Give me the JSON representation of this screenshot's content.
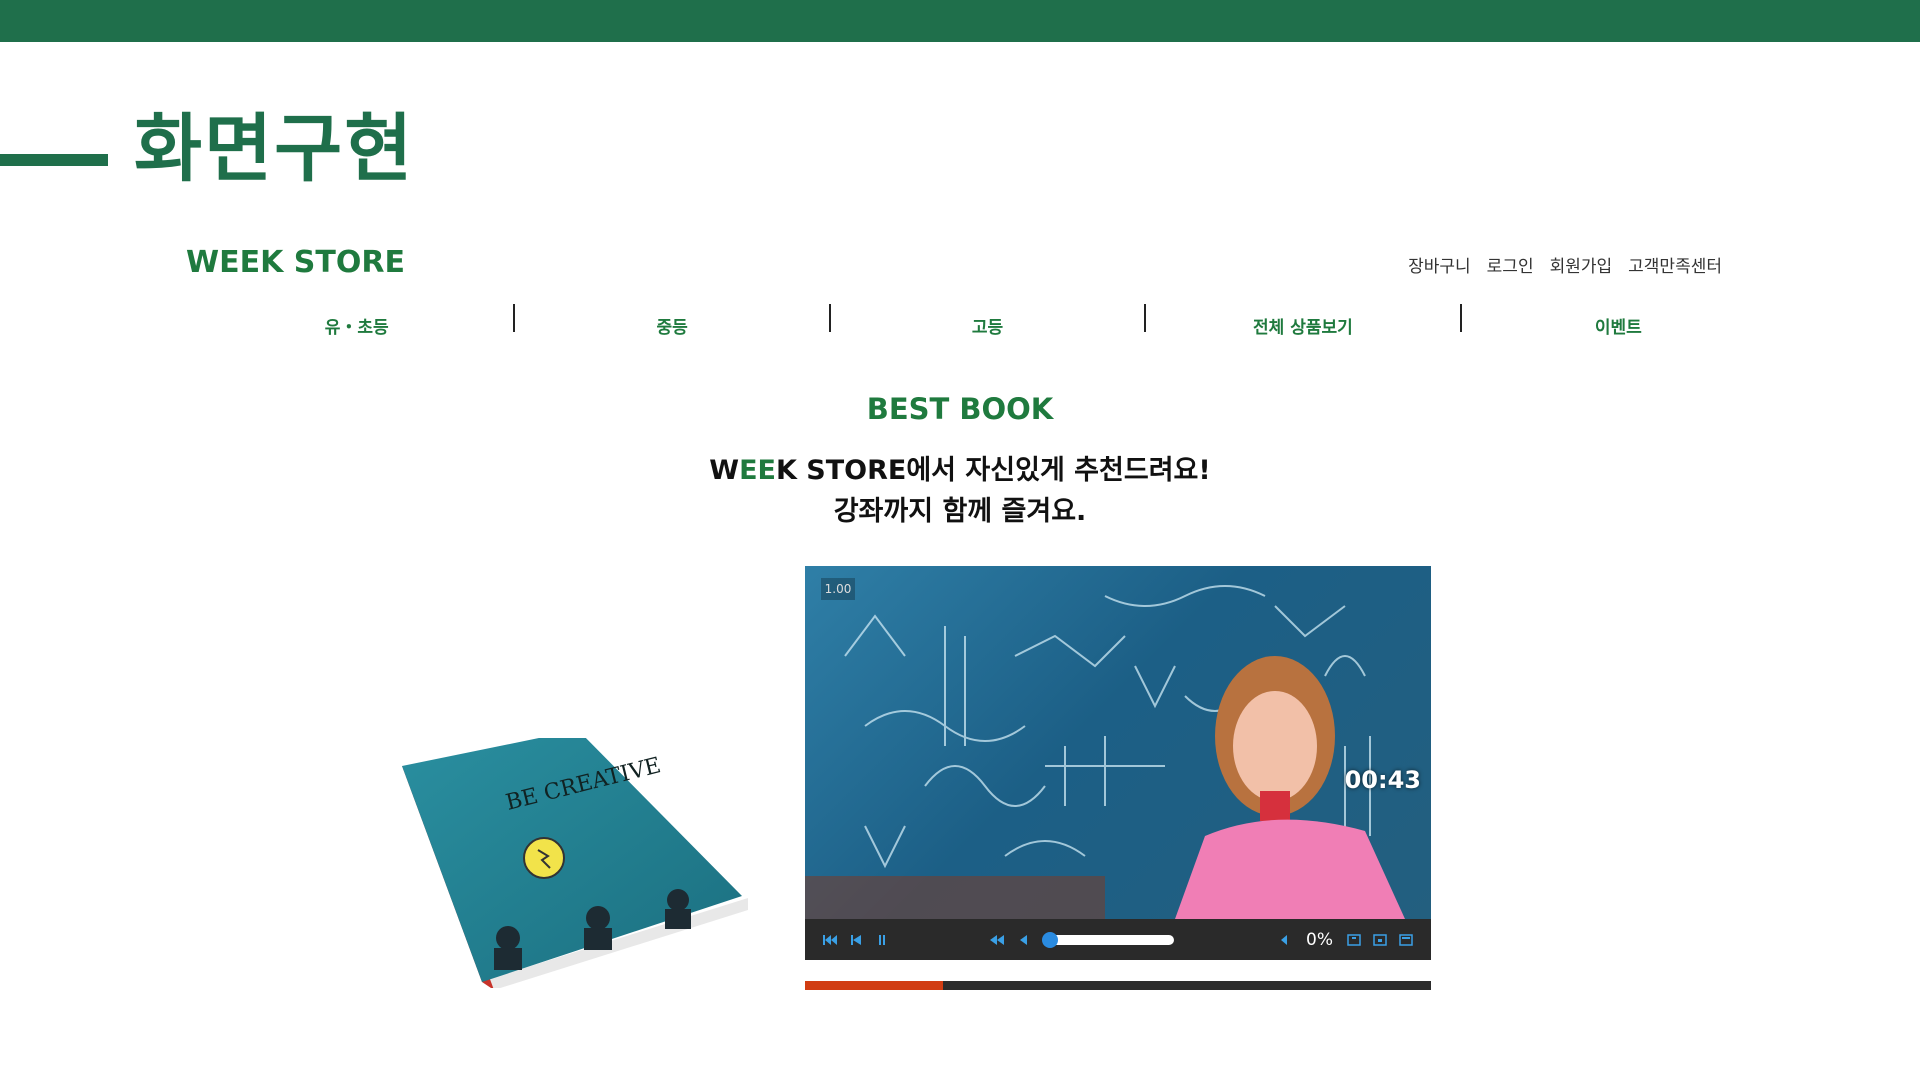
{
  "slide": {
    "title": "화면구현"
  },
  "header": {
    "brand": "WEEK STORE",
    "links": [
      "장바구니",
      "로그인",
      "회원가입",
      "고객만족센터"
    ]
  },
  "nav": {
    "items": [
      "유・초등",
      "중등",
      "고등",
      "전체 상품보기",
      "이벤트"
    ]
  },
  "section": {
    "title": "BEST BOOK",
    "line1_pre": "W",
    "line1_ee": "EE",
    "line1_post": "K STORE에서 자신있게 추천드려요!",
    "line2": "강좌까지 함께 즐겨요."
  },
  "book": {
    "cover_text": "BE CREATIVE"
  },
  "player": {
    "speed": "1.00",
    "timecode": "00:43",
    "volume_label": "0%",
    "volume_level": 0,
    "progress": 0.22
  },
  "colors": {
    "brand_green": "#1f6f4b",
    "nav_green": "#1f7a3e",
    "player_accent": "#3aa0e6",
    "progress": "#d13d13"
  }
}
